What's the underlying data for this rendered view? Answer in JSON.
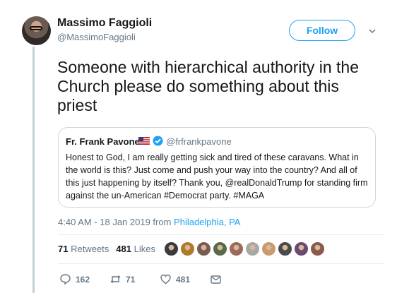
{
  "author": {
    "name": "Massimo Faggioli",
    "handle": "@MassimoFaggioli"
  },
  "follow_label": "Follow",
  "tweet_text": "Someone with hierarchical authority in the Church please do something about this priest",
  "quote": {
    "name": "Fr. Frank Pavone",
    "handle": "@frfrankpavone",
    "text": "Honest to God, I am really getting sick and tired of these caravans. What in the world is this? Just come and push your way into the country? And all of this just happening by itself? Thank you, @realDonaldTrump for standing firm against the un-American #Democrat party. #MAGA"
  },
  "timestamp": {
    "time": "4:40 AM - 18 Jan 2019 from ",
    "location": "Philadelphia, PA"
  },
  "stats": {
    "retweets_count": "71",
    "retweets_label": "Retweets",
    "likes_count": "481",
    "likes_label": "Likes"
  },
  "liker_colors": [
    "#3b3b3b",
    "#b07a2c",
    "#7a5d52",
    "#5a6b4c",
    "#9c6a5a",
    "#a8a8a8",
    "#c99a6b",
    "#4a4a4a",
    "#6a4b6b",
    "#8a5a4a"
  ],
  "actions": {
    "replies": "162",
    "retweets": "71",
    "likes": "481"
  },
  "colors": {
    "accent": "#1da1f2",
    "muted": "#657786"
  }
}
